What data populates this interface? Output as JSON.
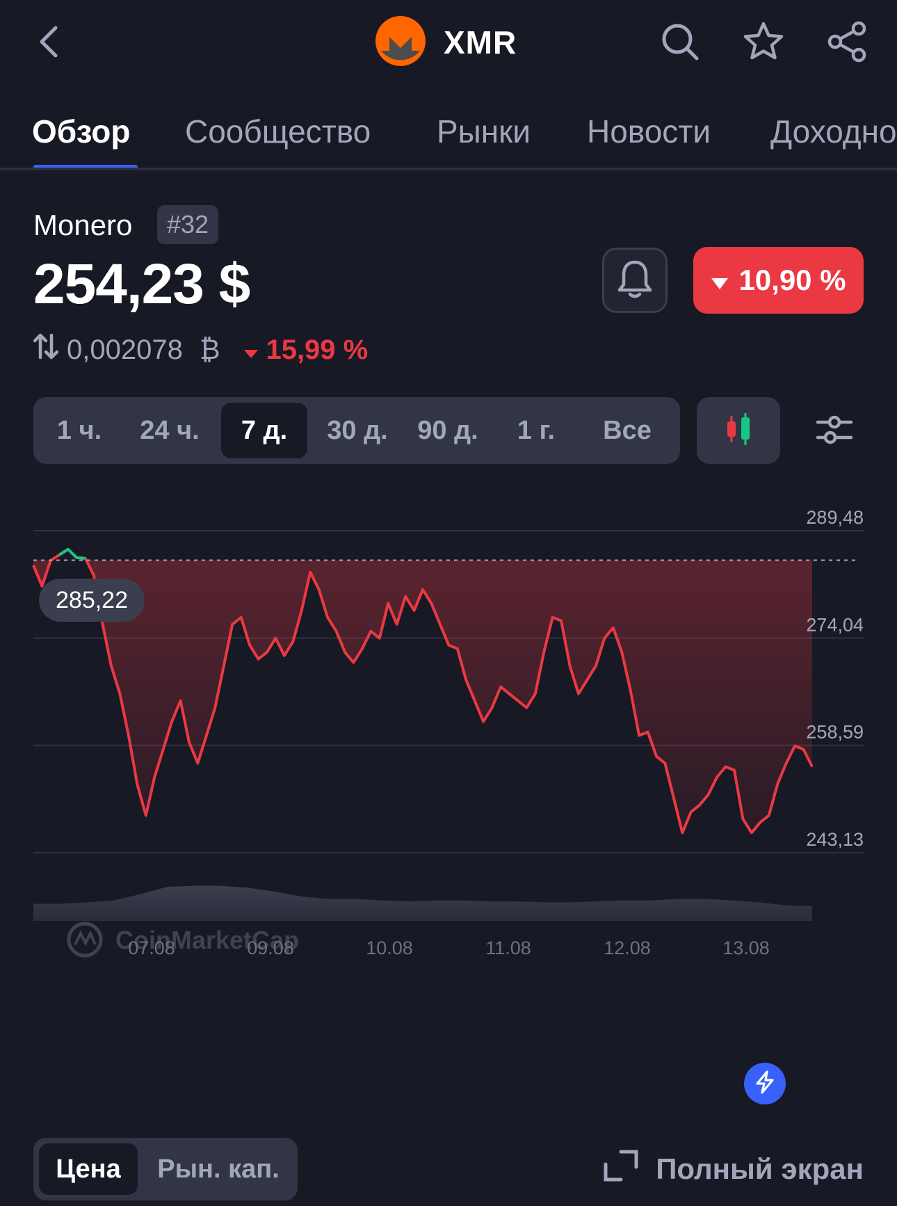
{
  "header": {
    "ticker": "XMR",
    "icons": [
      "chevron-left-icon",
      "monero-logo",
      "search-icon",
      "star-icon",
      "share-icon"
    ]
  },
  "tabs": [
    {
      "label": "Обзор",
      "active": true
    },
    {
      "label": "Сообщество"
    },
    {
      "label": "Рынки"
    },
    {
      "label": "Новости"
    },
    {
      "label": "Доходность"
    }
  ],
  "coin": {
    "name": "Monero",
    "rank": "#32",
    "price": "254,23 $",
    "change_24h": "10,90 %",
    "btc_price": "0,002078",
    "btc_symbol": "₿",
    "btc_change": "15,99 %"
  },
  "ranges": [
    {
      "label": "1 ч."
    },
    {
      "label": "24 ч."
    },
    {
      "label": "7 д.",
      "active": true
    },
    {
      "label": "30 д."
    },
    {
      "label": "90 д."
    },
    {
      "label": "1 г."
    },
    {
      "label": "Все"
    }
  ],
  "chart_data": {
    "type": "area",
    "title": "",
    "xlabel": "",
    "ylabel": "",
    "y_ticks": [
      "289,48",
      "274,04",
      "258,59",
      "243,13"
    ],
    "ylim": [
      243.13,
      289.48
    ],
    "x_ticks": [
      "07.08",
      "09.08",
      "10.08",
      "11.08",
      "12.08",
      "13.08"
    ],
    "open_price": 285.22,
    "open_price_label": "285,22",
    "watermark": "CoinMarketCap",
    "colors": {
      "down": "#ea3943",
      "up": "#16c784"
    },
    "series": [
      {
        "values": [
          284.5,
          281.5,
          285.2,
          286.0,
          286.8,
          285.6,
          285.5,
          283.0,
          276.0,
          270.0,
          266.0,
          260.0,
          253.0,
          248.5,
          254.0,
          258.0,
          262.0,
          265.0,
          259.0,
          256.0,
          260.0,
          264.0,
          270.0,
          276.0,
          277.0,
          273.0,
          271.0,
          272.0,
          274.0,
          271.5,
          273.5,
          278.0,
          283.5,
          281.0,
          277.0,
          275.0,
          272.0,
          270.5,
          272.5,
          275.0,
          274.0,
          279.0,
          276.0,
          280.0,
          278.0,
          281.0,
          279.0,
          276.0,
          273.0,
          272.5,
          268.0,
          265.0,
          262.0,
          264.0,
          267.0,
          266.0,
          265.0,
          264.0,
          266.0,
          272.0,
          277.0,
          276.5,
          270.0,
          266.0,
          268.0,
          270.0,
          274.0,
          275.5,
          272.0,
          266.5,
          260.0,
          260.5,
          257.0,
          256.0,
          251.0,
          246.0,
          249.0,
          250.0,
          251.5,
          254.0,
          255.5,
          255.0,
          248.0,
          246.0,
          247.5,
          248.5,
          253.0,
          256.0,
          258.5,
          258.0,
          255.5
        ]
      }
    ]
  },
  "bottom": {
    "toggle": [
      {
        "label": "Цена",
        "active": true
      },
      {
        "label": "Рын. кап."
      }
    ],
    "fullscreen_label": "Полный экран"
  }
}
